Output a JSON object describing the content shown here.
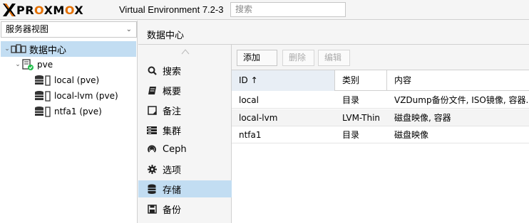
{
  "topbar": {
    "logo_text_1": "PR",
    "logo_o": "O",
    "logo_text_2": "XM",
    "logo_o2": "O",
    "logo_text_3": "X",
    "version": "Virtual Environment 7.2-3",
    "search_placeholder": "搜索"
  },
  "left": {
    "view_selector": "服务器视图",
    "tree": [
      {
        "label": "数据中心",
        "icon": "datacenter-icon"
      },
      {
        "label": "pve",
        "icon": "server-online-icon"
      },
      {
        "label": "local (pve)",
        "icon": "storage-icon"
      },
      {
        "label": "local-lvm (pve)",
        "icon": "storage-icon"
      },
      {
        "label": "ntfa1 (pve)",
        "icon": "storage-icon"
      }
    ]
  },
  "right": {
    "title": "数据中心",
    "menu": [
      {
        "label": "搜索",
        "icon": "search-icon"
      },
      {
        "label": "概要",
        "icon": "book-icon"
      },
      {
        "label": "备注",
        "icon": "note-icon"
      },
      {
        "label": "集群",
        "icon": "server-stack-icon"
      },
      {
        "label": "Ceph",
        "icon": "ceph-icon"
      },
      {
        "label": "选项",
        "icon": "gear-icon"
      },
      {
        "label": "存储",
        "icon": "database-icon"
      },
      {
        "label": "备份",
        "icon": "floppy-icon"
      }
    ],
    "toolbar": {
      "add": "添加",
      "remove": "删除",
      "edit": "编辑"
    },
    "columns": [
      "ID ↑",
      "类别",
      "内容"
    ],
    "rows": [
      {
        "id": "local",
        "type": "目录",
        "content": "VZDump备份文件, ISO镜像, 容器..."
      },
      {
        "id": "local-lvm",
        "type": "LVM-Thin",
        "content": "磁盘映像, 容器"
      },
      {
        "id": "ntfa1",
        "type": "目录",
        "content": "磁盘映像"
      }
    ]
  },
  "colors": {
    "accent_orange": "#e57000",
    "selection_blue": "#c2ddf2",
    "online_green": "#21bf4b"
  }
}
